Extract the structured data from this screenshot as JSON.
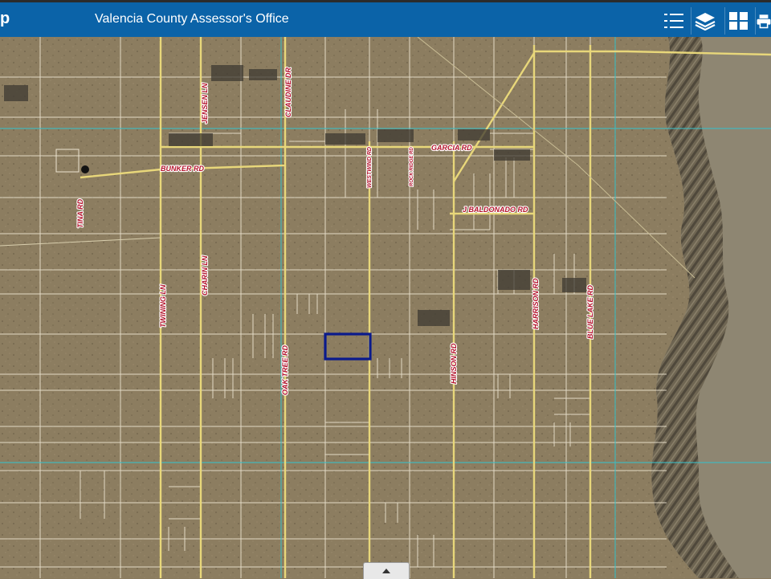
{
  "header": {
    "app_fragment": "p",
    "title": "Valencia County Assessor's Office",
    "tools": [
      {
        "icon": "list-icon"
      },
      {
        "icon": "layers-icon"
      },
      {
        "icon": "basemap-gallery-icon"
      },
      {
        "icon": "print-icon"
      }
    ]
  },
  "map": {
    "road_labels": {
      "jensen": "JENSEN LN",
      "claudine": "CLAUDINE DR",
      "garcia": "GARCIA RD",
      "bunker": "BUNKER RD",
      "tina": "TINA RD",
      "westwind": "WESTWIND RD",
      "rockridge": "ROCK RIDGE RD",
      "baldonado": "J BALDONADO RD",
      "charin": "CHARIN LN",
      "twining": "TWINING LN",
      "harrison": "HARRISON RD",
      "bluelake": "BLUE LAKE RD",
      "oaktree": "OAK TREE RD",
      "hinson": "HINSON RD"
    },
    "colors": {
      "terrain": "#8a7a5e",
      "parcel_line": "#ece4d0",
      "road": "#e8d77a",
      "section_line": "#38c0c8",
      "selection": "#0a1a8c"
    }
  },
  "footer": {
    "expand_icon": "caret-up-icon"
  }
}
